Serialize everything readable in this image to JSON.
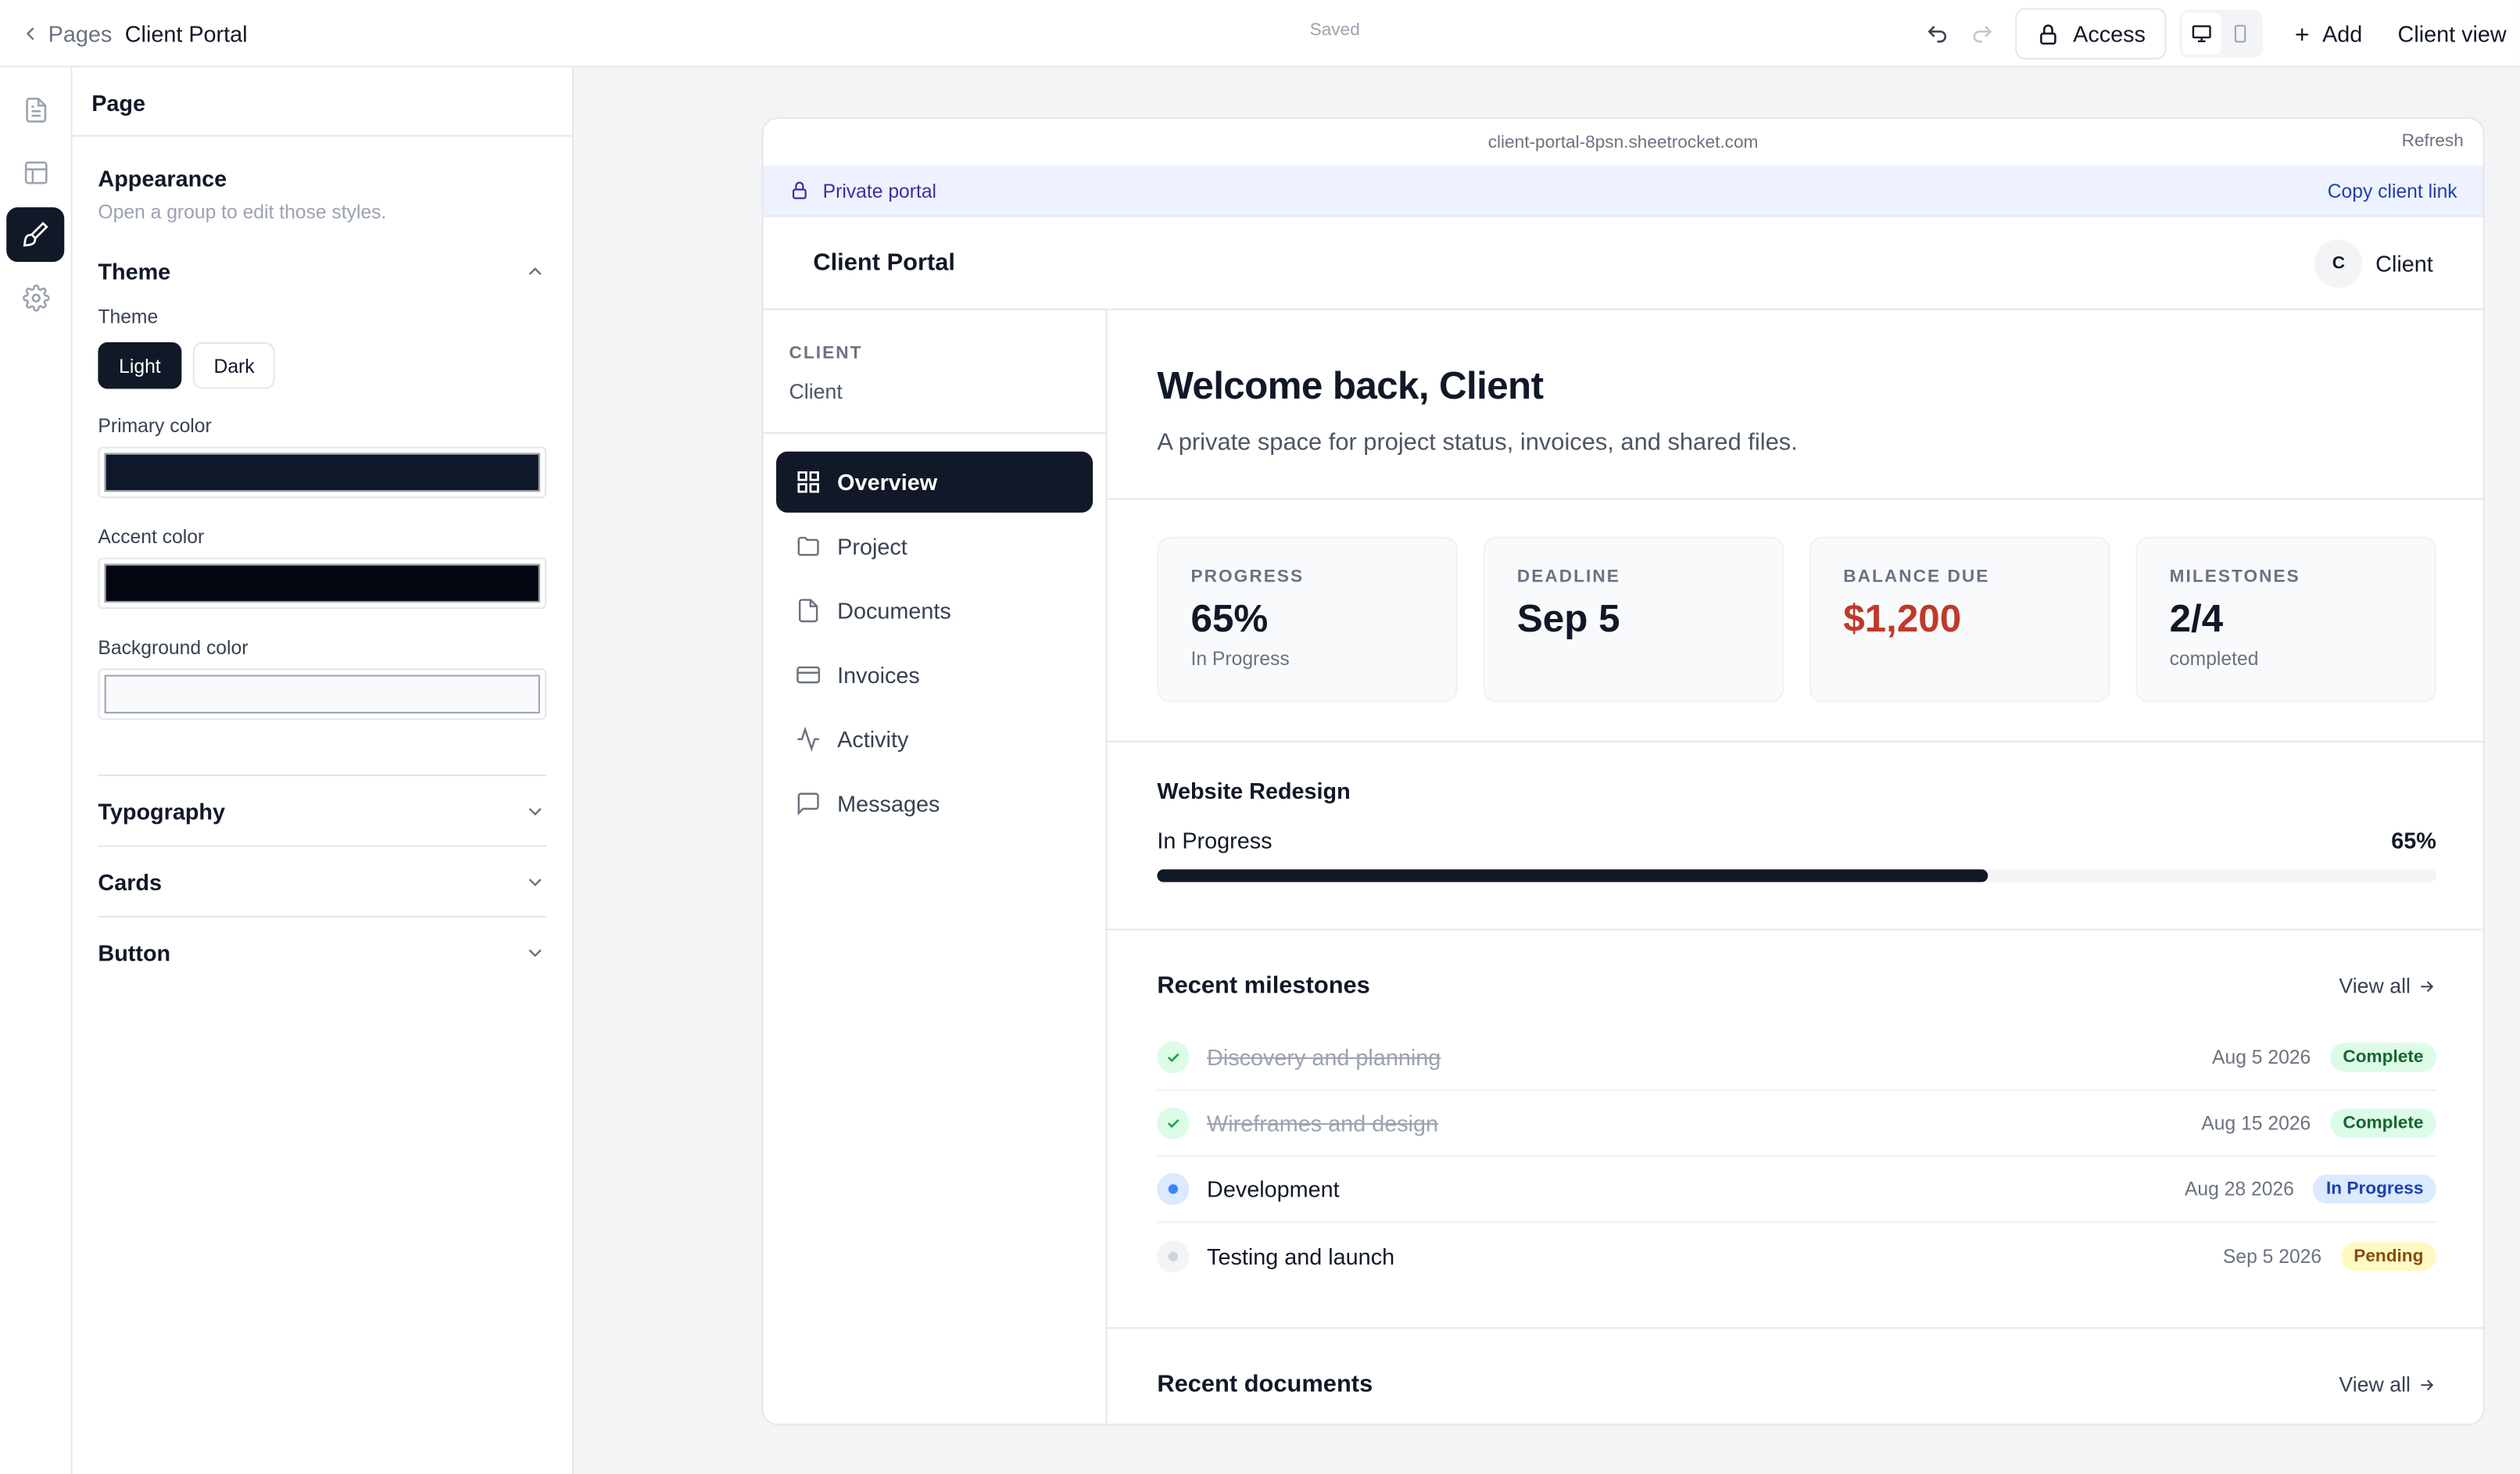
{
  "topbar": {
    "breadcrumb_parent": "Pages",
    "breadcrumb_current": "Client Portal",
    "save_status": "Saved",
    "access_label": "Access",
    "add_label": "Add",
    "view_label": "Client view"
  },
  "panel": {
    "title": "Page",
    "appearance_title": "Appearance",
    "appearance_hint": "Open a group to edit those styles.",
    "theme_group": "Theme",
    "theme_label": "Theme",
    "theme_options": [
      "Light",
      "Dark"
    ],
    "theme_selected": "Light",
    "primary_color_label": "Primary color",
    "primary_color": "#0f172a",
    "accent_color_label": "Accent color",
    "accent_color": "#030712",
    "background_color_label": "Background color",
    "background_color": "#f9fafb",
    "groups": [
      "Typography",
      "Cards",
      "Button"
    ]
  },
  "preview": {
    "url": "client-portal-8psn.sheetrocket.com",
    "refresh_label": "Refresh",
    "banner_label": "Private portal",
    "copy_link_label": "Copy client link",
    "brand": "Client Portal",
    "avatar_initial": "C",
    "user_name": "Client",
    "sidebar": {
      "context_label": "CLIENT",
      "context_value": "Client",
      "items": [
        "Overview",
        "Project",
        "Documents",
        "Invoices",
        "Activity",
        "Messages"
      ]
    },
    "welcome_title": "Welcome back, Client",
    "welcome_sub": "A private space for project status, invoices, and shared files.",
    "stats": [
      {
        "label": "PROGRESS",
        "value": "65%",
        "sub": "In Progress"
      },
      {
        "label": "DEADLINE",
        "value": "Sep 5",
        "sub": ""
      },
      {
        "label": "BALANCE DUE",
        "value": "$1,200",
        "sub": ""
      },
      {
        "label": "MILESTONES",
        "value": "2/4",
        "sub": "completed"
      }
    ],
    "balance_color": "#c0392b",
    "project": {
      "name": "Website Redesign",
      "status": "In Progress",
      "percent_label": "65%",
      "progress": 0.65
    },
    "milestones": {
      "title": "Recent milestones",
      "view_all": "View all",
      "items": [
        {
          "name": "Discovery and planning",
          "date": "Aug 5 2026",
          "status": "Complete"
        },
        {
          "name": "Wireframes and design",
          "date": "Aug 15 2026",
          "status": "Complete"
        },
        {
          "name": "Development",
          "date": "Aug 28 2026",
          "status": "In Progress"
        },
        {
          "name": "Testing and launch",
          "date": "Sep 5 2026",
          "status": "Pending"
        }
      ]
    },
    "documents": {
      "title": "Recent documents",
      "view_all": "View all"
    }
  }
}
